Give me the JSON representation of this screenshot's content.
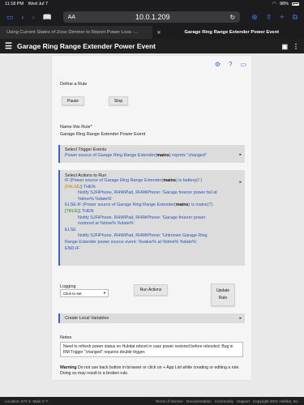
{
  "status": {
    "time": "11:18 PM",
    "date": "Wed Jul 7",
    "battery": "98%"
  },
  "browser": {
    "aa": "AA",
    "url": "10.0.1.209",
    "tabs": [
      {
        "label": "Using Current States of Zooz Dimmer to Report Power Loss -...",
        "active": false
      },
      {
        "label": "Garage Ring Range Extender Power Event",
        "active": true
      }
    ]
  },
  "app": {
    "title": "Garage Ring Range Extender Power Event"
  },
  "rule": {
    "define_label": "Define a Rule",
    "pause_label": "Pause",
    "stop_label": "Stop",
    "name_label": "Name this Rule*",
    "name_value": "Garage Ring Range Extender Power Event",
    "trigger_header": "Select Trigger Events",
    "trigger_text": "Power source of Garage Ring Range Extender(mains) reports \"changed\"",
    "actions_header": "Select Actions to Run",
    "actions": [
      {
        "a": "IF (Power source of Garage Ring Range Extender(",
        "b": "mains",
        "c": ") is battery(",
        "d": "F",
        "e": ")"
      },
      {
        "a": "[FALSE]",
        "b": ") THEN"
      },
      {
        "text": "Notify SJFiPhone, RHWiPad, RHWiPhone: 'Garage freezer power fail at"
      },
      {
        "text": "%time% %date%'"
      },
      {
        "a": "ELSE-IF (Power source of Garage Ring Range Extender(",
        "b": "mains",
        "c": ") is mains(",
        "d": "T",
        "e": ")"
      },
      {
        "a": "[TRUE]",
        "b": ") THEN"
      },
      {
        "text": "Notify SJFiPhone, RHWiPad, RHWiPhone: 'Garage freezer power"
      },
      {
        "text": "restored at %time% %date%'"
      },
      {
        "text": "ELSE"
      },
      {
        "text": "Notify SJFiPhone, RHWiPad, RHWiPhone: 'Unknown Garage Ring"
      },
      {
        "text": "Range Extender power source event: %value% at %time% %date%'"
      },
      {
        "text": "END-IF"
      }
    ],
    "logging_label": "Logging",
    "logging_select": "Click to set",
    "run_actions_label": "Run Actions",
    "update_rule_line1": "Update",
    "update_rule_line2": "Rule",
    "local_vars_label": "Create Local Variables",
    "notes_label": "Notes",
    "notes_text": "Need to refresh power status on Hubitat reboot in case power restored before rebooted. Bug in RM Trigger \"changed\" requires double trigger.",
    "warning_bold": "Warning",
    "warning_text": " Do not use back button in browser or click on + App List while creating or editing a rule. Doing so may result in a broken rule."
  },
  "footer": {
    "location": "Location: 672 S. Main C-7",
    "links": [
      "Terms of Service",
      "Documentation",
      "Community",
      "Support",
      "Copyright 2021 Hubitat, Inc."
    ]
  }
}
